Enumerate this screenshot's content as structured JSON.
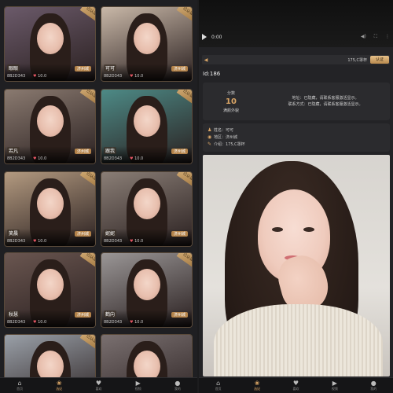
{
  "left_panel": {
    "cards": [
      {
        "name": "眼眼",
        "city": "济州城",
        "id": "8B2D343",
        "likes": "10.0",
        "badge": "已认证",
        "bg": "#6b5a6a"
      },
      {
        "name": "可可",
        "city": "济州城",
        "id": "8B2D343",
        "likes": "10.0",
        "badge": "已认证",
        "bg": "#c9b8a8"
      },
      {
        "name": "若凡",
        "city": "济州城",
        "id": "8B2D343",
        "likes": "10.0",
        "badge": "已认证",
        "bg": "#8a7a70"
      },
      {
        "name": "跟我",
        "city": "济州城",
        "id": "8B2D343",
        "likes": "10.0",
        "badge": "已认证",
        "bg": "#4d8a86"
      },
      {
        "name": "笑晨",
        "city": "济州城",
        "id": "8B2D343",
        "likes": "10.0",
        "badge": "已认证",
        "bg": "#b39a80"
      },
      {
        "name": "妮妮",
        "city": "济州城",
        "id": "8B2D343",
        "likes": "10.0",
        "badge": "已认证",
        "bg": "#8a7e76"
      },
      {
        "name": "秋慧",
        "city": "济州城",
        "id": "8B2D343",
        "likes": "10.0",
        "badge": "已认证",
        "bg": "#6a5650"
      },
      {
        "name": "鹤向",
        "city": "济州城",
        "id": "8B2D343",
        "likes": "10.0",
        "badge": "已认证",
        "bg": "#9a9696"
      },
      {
        "name": "",
        "city": "",
        "id": "",
        "likes": "",
        "badge": "已认证",
        "bg": "#9aa0a8"
      },
      {
        "name": "",
        "city": "",
        "id": "",
        "likes": "",
        "badge": "",
        "bg": "#7a7070"
      }
    ],
    "nav": [
      {
        "label": "首页",
        "icon": "home-icon",
        "glyph": "⌂",
        "active": false
      },
      {
        "label": "选妃",
        "icon": "gift-icon",
        "glyph": "❀",
        "active": true
      },
      {
        "label": "喜欢",
        "icon": "heart-icon",
        "glyph": "♥",
        "active": false
      },
      {
        "label": "视频",
        "icon": "video-icon",
        "glyph": "▶",
        "active": false
      },
      {
        "label": "我的",
        "icon": "user-icon",
        "glyph": "●",
        "active": false
      }
    ]
  },
  "right_panel": {
    "video": {
      "time": "0:00"
    },
    "notice": {
      "text": "175,C罩杯",
      "button": "认证"
    },
    "id_label": "Id:186",
    "score": {
      "label": "分数",
      "value": "10",
      "sub": "满颜外貌",
      "line1": "地址：已隐藏，请联系客服激活显示。",
      "line2": "联系方式：已隐藏，请联系客服激活显示。"
    },
    "info": [
      {
        "icon": "user-icon",
        "glyph": "♟",
        "text": "姓名：可可"
      },
      {
        "icon": "location-icon",
        "glyph": "◉",
        "text": "地区：济州城"
      },
      {
        "icon": "info-icon",
        "glyph": "✎",
        "text": "介绍：175,C罩杯"
      }
    ],
    "nav": [
      {
        "label": "首页",
        "icon": "home-icon",
        "glyph": "⌂",
        "active": false
      },
      {
        "label": "选妃",
        "icon": "gift-icon",
        "glyph": "❀",
        "active": true
      },
      {
        "label": "喜欢",
        "icon": "heart-icon",
        "glyph": "♥",
        "active": false
      },
      {
        "label": "视频",
        "icon": "video-icon",
        "glyph": "▶",
        "active": false
      },
      {
        "label": "我的",
        "icon": "user-icon",
        "glyph": "●",
        "active": false
      }
    ]
  },
  "colors": {
    "accent": "#d9a566",
    "background": "#1f1f22",
    "panel": "#2b2b2e"
  }
}
